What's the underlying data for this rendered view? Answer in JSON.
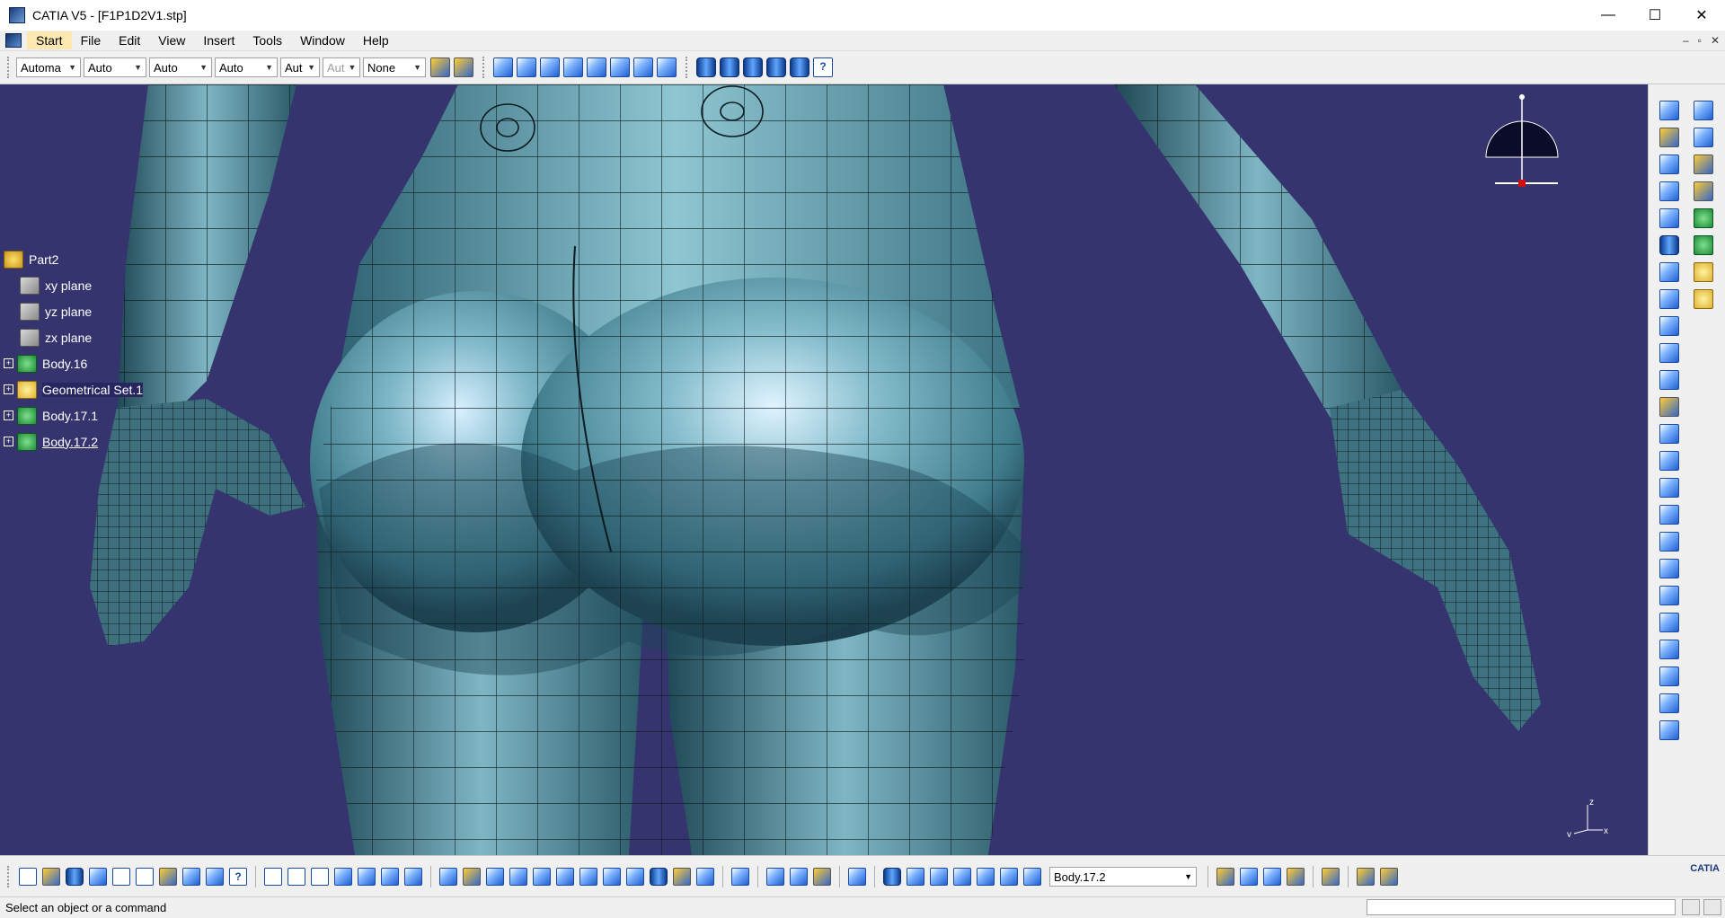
{
  "window": {
    "title": "CATIA V5 - [F1P1D2V1.stp]",
    "minimize": "—",
    "maximize": "☐",
    "close": "✕"
  },
  "menu": {
    "items": [
      "Start",
      "File",
      "Edit",
      "View",
      "Insert",
      "Tools",
      "Window",
      "Help"
    ],
    "mdi": [
      "–",
      "▫",
      "✕"
    ]
  },
  "toolbar1": {
    "combos": [
      "Automa",
      "Auto",
      "Auto",
      "Auto",
      "Aut",
      "Aut",
      "None"
    ]
  },
  "tree": {
    "root": "Part2",
    "nodes": [
      {
        "label": "xy plane",
        "icon": "plane-icon",
        "expandable": false
      },
      {
        "label": "yz plane",
        "icon": "plane-icon",
        "expandable": false
      },
      {
        "label": "zx plane",
        "icon": "plane-icon",
        "expandable": false
      },
      {
        "label": "Body.16",
        "icon": "body-icon",
        "expandable": true
      },
      {
        "label": "Geometrical Set.1",
        "icon": "geometrical-set-icon",
        "expandable": true
      },
      {
        "label": "Body.17.1",
        "icon": "body-icon",
        "expandable": true
      },
      {
        "label": "Body.17.2",
        "icon": "body-icon",
        "expandable": true
      }
    ]
  },
  "viewport": {
    "background": "#35346f",
    "axis_labels": {
      "z": "z",
      "x": "x",
      "y": "y"
    }
  },
  "bottom": {
    "current_body": "Body.17.2",
    "logo": "CATIA"
  },
  "status": {
    "message": "Select an object or a command"
  }
}
